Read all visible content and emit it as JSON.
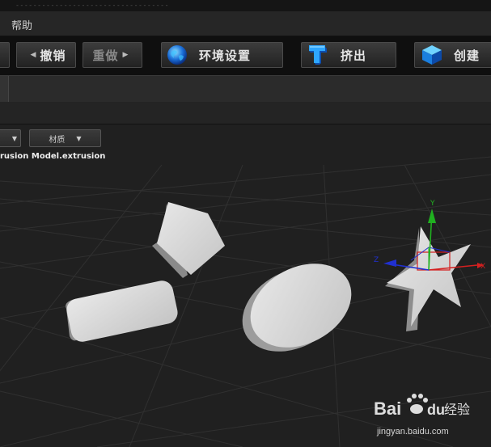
{
  "menubar": {
    "help_label": "帮助"
  },
  "toolbar": {
    "undo_label": "撤销",
    "redo_label": "重做",
    "env_label": "环境设置",
    "extrude_label": "挤出",
    "create_label": "创建",
    "env_icon": "globe-icon",
    "extrude_icon": "extrude-t-icon",
    "create_icon": "cube-icon"
  },
  "viewport": {
    "dropdown_left_label": "",
    "material_dropdown_label": "材质",
    "info_line": "rusion Model.extrusion",
    "axes": {
      "x_label": "X",
      "y_label": "Y",
      "z_label": "Z"
    },
    "shapes": [
      "pentagon",
      "rounded-rectangle",
      "ellipse",
      "star"
    ]
  },
  "watermark": {
    "brand": "Bai",
    "brand2": "du",
    "cn": "经验",
    "url": "jingyan.baidu.com"
  },
  "colors": {
    "background": "#1e1e1e",
    "grid": "#2e2e2e",
    "shape": "#d8d8d8",
    "axis_x": "#d42020",
    "axis_y": "#20b020",
    "axis_z": "#2030d0"
  }
}
